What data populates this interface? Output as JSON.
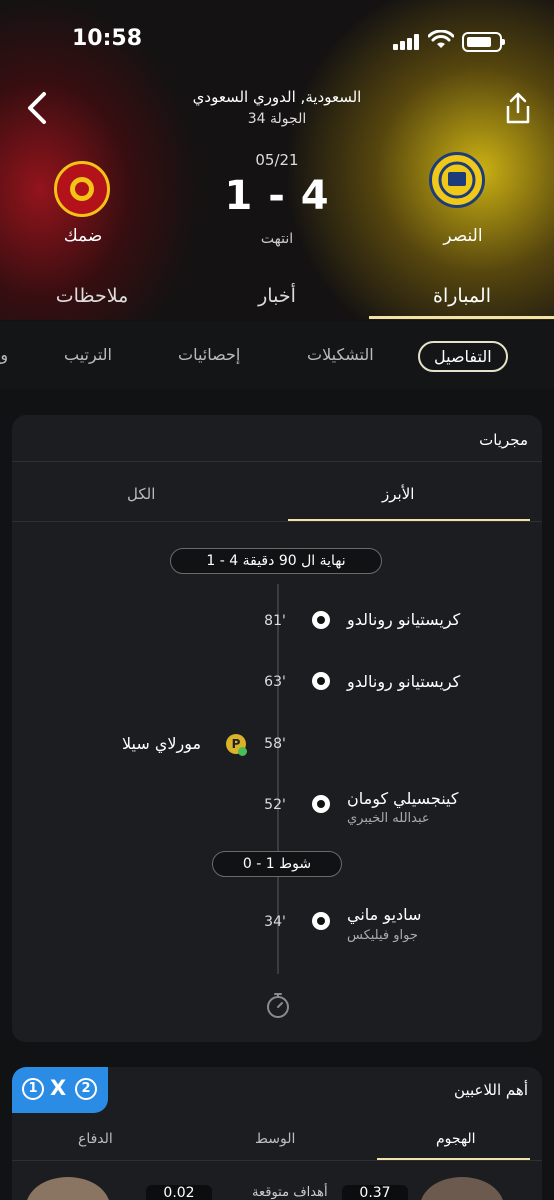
{
  "status_bar": {
    "time": "10:58"
  },
  "match": {
    "league": "السعودية, الدوري السعودي",
    "round": "الجولة 34",
    "date": "05/21",
    "score": "1 - 4",
    "status": "انتهت",
    "home_team": "النصر",
    "away_team": "ضمك",
    "colors": {
      "home": "#f0c818",
      "away": "#b3121a",
      "accent": "#f0e3a8"
    }
  },
  "main_tabs": [
    "المباراة",
    "أخبار",
    "ملاحظات"
  ],
  "sub_tabs": [
    "التفاصيل",
    "التشكيلات",
    "إحصائيات",
    "الترتيب",
    "وج"
  ],
  "events": {
    "title": "مجريات",
    "segments": [
      "الأبرز",
      "الكل"
    ],
    "full_time": "نهاية ال 90 دقيقة 4 - 1",
    "half_time": "شوط 1 - 0",
    "items": [
      {
        "minute": "81'",
        "player": "كريستيانو رونالدو",
        "assist": ""
      },
      {
        "minute": "63'",
        "player": "كريستيانو رونالدو",
        "assist": ""
      },
      {
        "minute": "58'",
        "player": "مورلاي سيلا",
        "assist": ""
      },
      {
        "minute": "52'",
        "player": "كينجسيلي كومان",
        "assist": "عبدالله الخيبري"
      },
      {
        "minute": "34'",
        "player": "ساديو ماني",
        "assist": "جواو فيليكس"
      }
    ]
  },
  "top_players": {
    "title": "أهم اللاعبين",
    "odds": [
      "1",
      "X",
      "2"
    ],
    "tabs": [
      "الهجوم",
      "الوسط",
      "الدفاع"
    ],
    "stats": [
      "0.37",
      "0.02"
    ],
    "label": "أهداف متوقعة"
  }
}
